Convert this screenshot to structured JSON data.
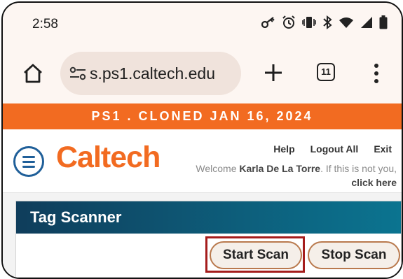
{
  "status_bar": {
    "time": "2:58",
    "icons": [
      "key-icon",
      "alarm-icon",
      "vibrate-icon",
      "bluetooth-icon",
      "wifi-icon",
      "signal-icon",
      "battery-icon"
    ]
  },
  "browser": {
    "url": "s.ps1.caltech.edu",
    "tab_count": "11"
  },
  "banner": {
    "text": "PS1 . CLONED JAN 16, 2024",
    "color": "#f26b21"
  },
  "header": {
    "logo": "Caltech",
    "links": {
      "help": "Help",
      "logout": "Logout All",
      "exit": "Exit"
    },
    "welcome_prefix": "Welcome ",
    "user_name": "Karla De La Torre",
    "welcome_mid": ". If this is not you, ",
    "click_here": "click here"
  },
  "panel": {
    "title": "Tag Scanner",
    "start_label": "Start Scan",
    "stop_label": "Stop Scan"
  },
  "colors": {
    "brand_orange": "#f26b21",
    "panel_header": "#0d5f7c",
    "highlight": "#a51c1c"
  }
}
